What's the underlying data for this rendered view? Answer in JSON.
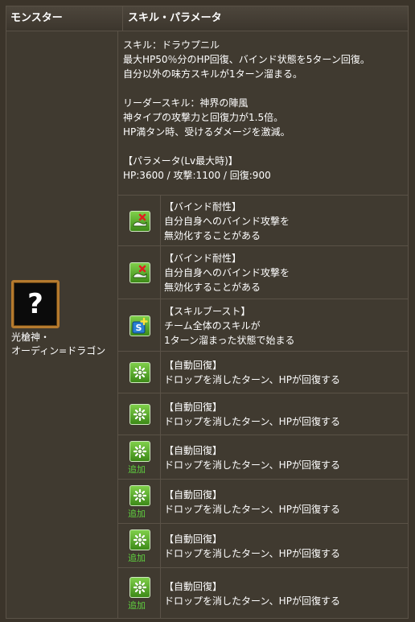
{
  "header": {
    "col_monster": "モンスター",
    "col_skill": "スキル・パラメータ"
  },
  "monster": {
    "thumb_glyph": "?",
    "name_line1": "光槍神・",
    "name_line2": "オーディン=ドラゴン"
  },
  "info": {
    "skill_name": "スキル：ドラウプニル",
    "skill_desc1": "最大HP50％分のHP回復、バインド状態を5ターン回復。",
    "skill_desc2": "自分以外の味方スキルが1ターン溜まる。",
    "leader_name": "リーダースキル：神界の陣風",
    "leader_desc1": "神タイプの攻撃力と回復力が1.5倍。",
    "leader_desc2": "HP満タン時、受けるダメージを激減。",
    "param_title": "【パラメータ(Lv最大時)】",
    "param_values": "HP:3600 / 攻撃:1100 / 回復:900"
  },
  "awakenings": [
    {
      "icon": "bind-resist-icon",
      "extra": "",
      "lines": [
        "【バインド耐性】",
        "自分自身へのバインド攻撃を",
        "無効化することがある"
      ]
    },
    {
      "icon": "bind-resist-icon",
      "extra": "",
      "lines": [
        "【バインド耐性】",
        "自分自身へのバインド攻撃を",
        "無効化することがある"
      ]
    },
    {
      "icon": "skill-boost-icon",
      "extra": "",
      "lines": [
        "【スキルブースト】",
        "チーム全体のスキルが",
        "1ターン溜まった状態で始まる"
      ]
    },
    {
      "icon": "auto-heal-icon",
      "extra": "",
      "lines": [
        "【自動回復】",
        "ドロップを消したターン、HPが回復する"
      ]
    },
    {
      "icon": "auto-heal-icon",
      "extra": "",
      "lines": [
        "【自動回復】",
        "ドロップを消したターン、HPが回復する"
      ]
    },
    {
      "icon": "auto-heal-icon",
      "extra": "追加",
      "lines": [
        "【自動回復】",
        "ドロップを消したターン、HPが回復する"
      ]
    },
    {
      "icon": "auto-heal-icon",
      "extra": "追加",
      "lines": [
        "【自動回復】",
        "ドロップを消したターン、HPが回復する"
      ]
    },
    {
      "icon": "auto-heal-icon",
      "extra": "追加",
      "lines": [
        "【自動回復】",
        "ドロップを消したターン、HPが回復する"
      ]
    },
    {
      "icon": "auto-heal-icon",
      "extra": "追加",
      "lines": [
        "【自動回復】",
        "ドロップを消したターン、HPが回復する"
      ]
    }
  ],
  "colors": {
    "accent_green": "#5fcf3f",
    "thumb_border": "#b57a2e",
    "bind_mark": "#e02020"
  }
}
